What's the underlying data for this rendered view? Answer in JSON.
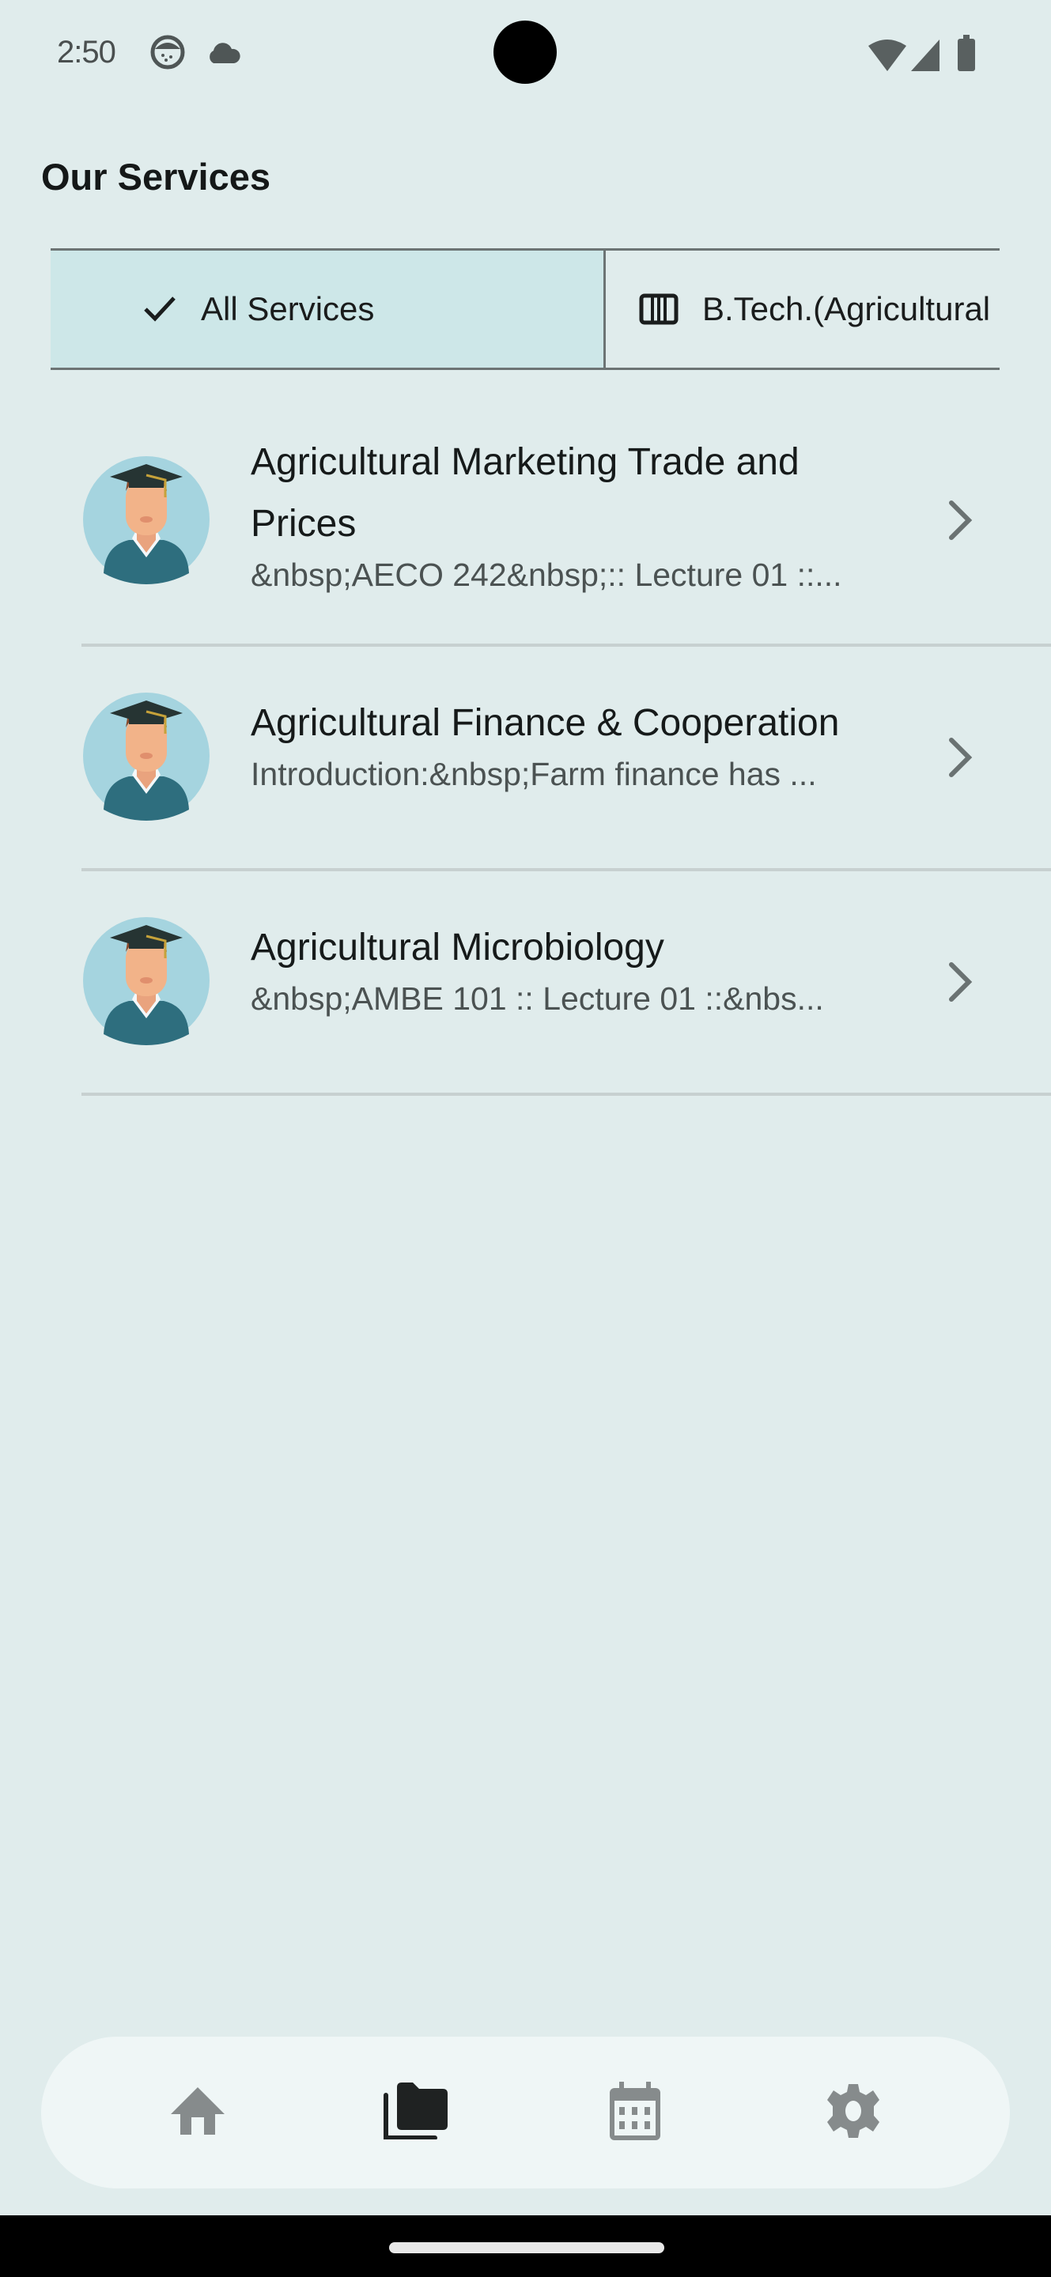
{
  "status_bar": {
    "time": "2:50",
    "left_icons": [
      "app-notification-icon",
      "cloud-icon"
    ],
    "right_icons": [
      "wifi-icon",
      "cell-signal-icon",
      "battery-icon"
    ]
  },
  "header": {
    "title": "Our Services"
  },
  "filters": [
    {
      "label": "All Services",
      "icon": "check-icon",
      "selected": true
    },
    {
      "label": "B.Tech.(Agricultural",
      "icon": "view-column-icon",
      "selected": false
    }
  ],
  "services": [
    {
      "title": "Agricultural Marketing Trade and Prices",
      "subtitle": "&nbsp;AECO 242&nbsp;:: Lecture 01 ::...",
      "avatar": "graduate-avatar"
    },
    {
      "title": "Agricultural Finance & Cooperation",
      "subtitle": "Introduction:&nbsp;Farm finance has ...",
      "avatar": "graduate-avatar"
    },
    {
      "title": "Agricultural Microbiology",
      "subtitle": "&nbsp;AMBE 101 :: Lecture 01 ::&nbs...",
      "avatar": "graduate-avatar"
    }
  ],
  "bottom_nav": [
    {
      "name": "home",
      "icon": "home-icon",
      "active": false
    },
    {
      "name": "services",
      "icon": "folder-copy-icon",
      "active": true
    },
    {
      "name": "calendar",
      "icon": "calendar-icon",
      "active": false
    },
    {
      "name": "settings",
      "icon": "gear-icon",
      "active": false
    }
  ],
  "colors": {
    "background": "#e0ecec",
    "chip_selected": "#cde7e8",
    "nav_background": "#eff6f6",
    "nav_active": "#1f2222",
    "nav_inactive": "#868b8c",
    "avatar_circle": "#a5d4df",
    "avatar_shirt": "#2e6e7e"
  }
}
